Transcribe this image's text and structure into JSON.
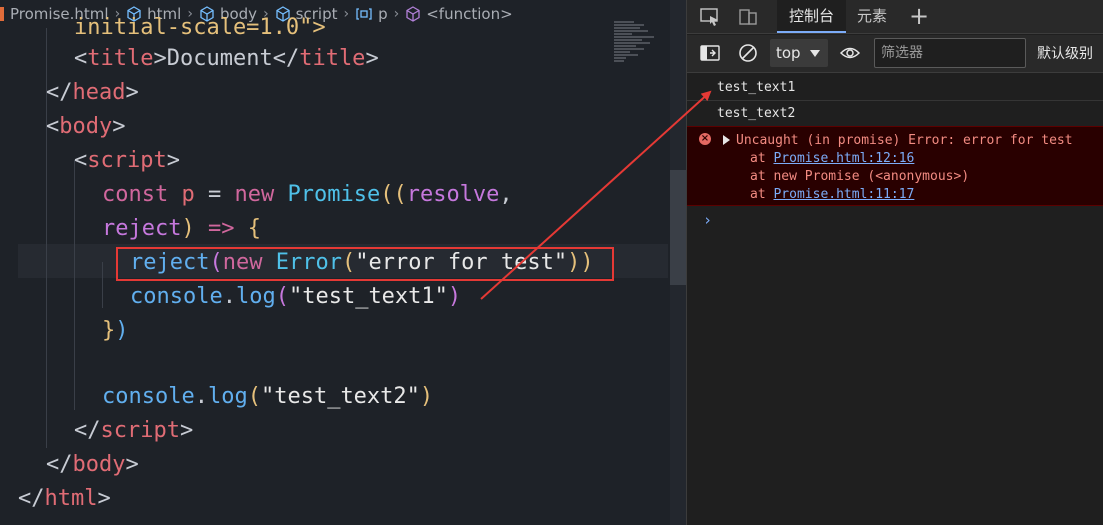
{
  "breadcrumb": {
    "items": [
      "Promise.html",
      "html",
      "body",
      "script",
      "p",
      "<function>"
    ]
  },
  "code": {
    "line0": {
      "a": "initial-scale=1.0\">"
    },
    "line1": {
      "open": "<",
      "name": "title",
      "close": ">",
      "text": "Document",
      "open2": "</",
      "name2": "title",
      "close2": ">"
    },
    "line2": {
      "open": "</",
      "name": "head",
      "close": ">"
    },
    "line3": {
      "open": "<",
      "name": "body",
      "close": ">"
    },
    "line4": {
      "open": "<",
      "name": "script",
      "close": ">"
    },
    "line5": {
      "kw": "const",
      "sp1": " ",
      "ident": "p",
      "eq": " = ",
      "kw2": "new",
      "sp2": " ",
      "cls": "Promise",
      "paren": "((",
      "param": "resolve",
      "comma": ","
    },
    "line6": {
      "param": "reject",
      "paren": ")",
      "arrow": " => ",
      "brace": "{"
    },
    "line7": {
      "fn": "reject",
      "p1": "(",
      "kw": "new",
      "sp": " ",
      "cls": "Error",
      "p2": "(",
      "str": "\"error for test\"",
      "p3": "))"
    },
    "line8": {
      "obj": "console",
      "dot": ".",
      "fn": "log",
      "p1": "(",
      "str": "\"test_text1\"",
      "p2": ")"
    },
    "line9": {
      "brace": "}",
      "paren": ")"
    },
    "line11": {
      "obj": "console",
      "dot": ".",
      "fn": "log",
      "p1": "(",
      "str": "\"test_text2\"",
      "p2": ")"
    },
    "line12": {
      "open": "</",
      "name": "script",
      "close": ">"
    },
    "line13": {
      "open": "</",
      "name": "body",
      "close": ">"
    },
    "line14": {
      "open": "</",
      "name": "html",
      "close": ">"
    }
  },
  "devtools": {
    "tabs": {
      "console": "控制台",
      "elements": "元素",
      "add": "+"
    },
    "toolbar": {
      "context": "top",
      "filter_placeholder": "筛选器",
      "levels": "默认级别"
    },
    "console": {
      "log1": "test_text1",
      "log2": "test_text2",
      "error": {
        "message": "Uncaught (in promise) Error: error for test",
        "at1_prefix": "at ",
        "at1_link": "Promise.html:12:16",
        "at2": "at new Promise (<anonymous>)",
        "at3_prefix": "at ",
        "at3_link": "Promise.html:11:17"
      },
      "prompt": "›"
    }
  },
  "colors": {
    "annotation": "#e53935",
    "editor_bg": "#1e2228",
    "error_bg": "#290000"
  }
}
